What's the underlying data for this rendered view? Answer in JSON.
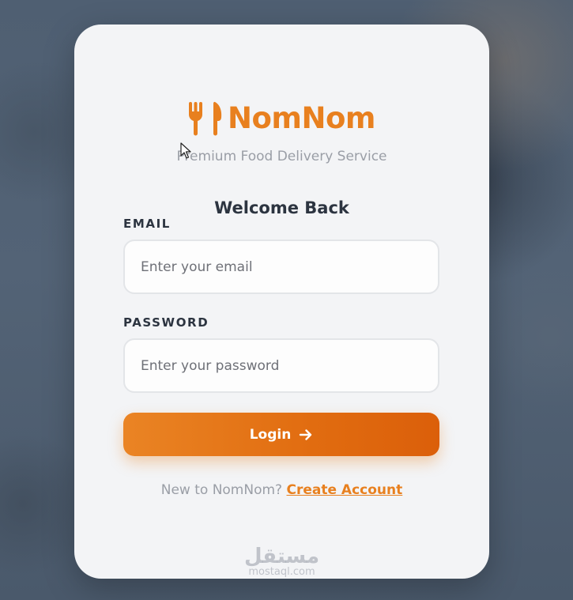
{
  "brand": {
    "name": "NomNom",
    "tagline": "Premium Food Delivery Service",
    "icon": "fork-knife-icon",
    "accent_color": "#e8801f"
  },
  "form": {
    "heading": "Welcome Back",
    "email": {
      "label": "EMAIL",
      "placeholder": "Enter your email",
      "value": ""
    },
    "password": {
      "label": "PASSWORD",
      "placeholder": "Enter your password",
      "value": ""
    },
    "submit": {
      "label": "Login",
      "icon": "arrow-right-icon"
    }
  },
  "signup": {
    "prompt": "New to NomNom?",
    "link_label": "Create Account"
  },
  "watermark": {
    "arabic": "مستقل",
    "latin": "mostaql.com"
  }
}
